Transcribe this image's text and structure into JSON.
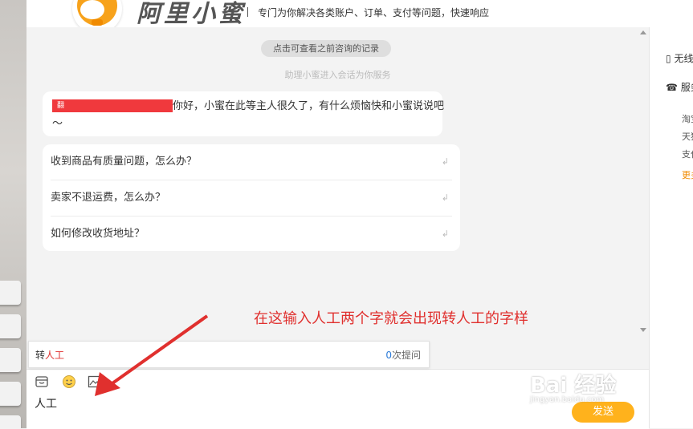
{
  "header": {
    "brand": "阿里小蜜",
    "tagline": "专门为你解决各类账户、订单、支付等问题，快速响应"
  },
  "chat": {
    "history_button": "点击可查看之前咨询的记录",
    "assistant_notice": "助理小蜜进入会话为你服务",
    "greeting_redacted": "翻",
    "greeting": "你好，小蜜在此等主人很久了，有什么烦恼快和小蜜说说吧～",
    "faq": [
      "收到商品有质量问题，怎么办？",
      "卖家不退运费，怎么办？",
      "如何修改收货地址？"
    ]
  },
  "annotation": "在这输入人工两个字就会出现转人工的字样",
  "suggestion": {
    "prefix": "转",
    "highlight": "人工",
    "count": "0",
    "count_suffix": "次提问"
  },
  "input": {
    "text": "人工",
    "send_label": "发送"
  },
  "right_panel": {
    "item1": "无线",
    "item2": "服务",
    "links": [
      "淘宝",
      "天猫",
      "支付"
    ],
    "more": "更多"
  },
  "watermark": {
    "logo": "Bai 经验",
    "url": "jingyan.baidu.com"
  },
  "colors": {
    "accent_orange": "#ffb21c",
    "highlight_red": "#e0302e",
    "link_blue": "#2a7ad8"
  }
}
